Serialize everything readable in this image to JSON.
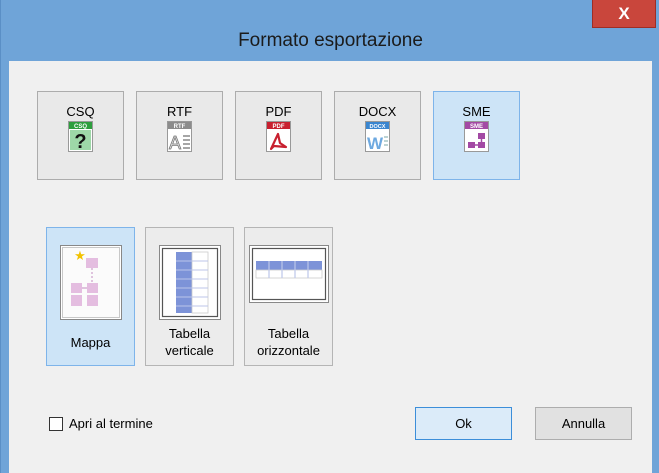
{
  "window": {
    "title": "Formato esportazione",
    "close_symbol": "X"
  },
  "formats": [
    {
      "label": "CSQ",
      "icon_text": "CSQ",
      "icon": "csq-help-icon",
      "selected": false
    },
    {
      "label": "RTF",
      "icon_text": "RTF",
      "icon": "rtf-document-icon",
      "selected": false
    },
    {
      "label": "PDF",
      "icon_text": "PDF",
      "icon": "pdf-document-icon",
      "selected": false
    },
    {
      "label": "DOCX",
      "icon_text": "DOCX",
      "icon": "docx-word-icon",
      "selected": false
    },
    {
      "label": "SME",
      "icon_text": "SME",
      "icon": "sme-map-icon",
      "selected": true
    }
  ],
  "modes": [
    {
      "line1": "Mappa",
      "line2": "",
      "icon": "map-layout-icon",
      "selected": true
    },
    {
      "line1": "Tabella",
      "line2": "verticale",
      "icon": "vertical-table-icon",
      "selected": false
    },
    {
      "line1": "Tabella",
      "line2": "orizzontale",
      "icon": "horizontal-table-icon",
      "selected": false
    }
  ],
  "options": {
    "open_at_end_label": "Apri al termine",
    "open_at_end_checked": false
  },
  "buttons": {
    "ok": "Ok",
    "cancel": "Annulla"
  },
  "colors": {
    "titlebar": "#6fa4d8",
    "close": "#c9463c",
    "selected": "#cde4f7",
    "csq": "#2e9e3e",
    "rtf": "#8c8c8c",
    "pdf": "#c8202f",
    "docx": "#3a86d0",
    "sme": "#a349a4"
  }
}
